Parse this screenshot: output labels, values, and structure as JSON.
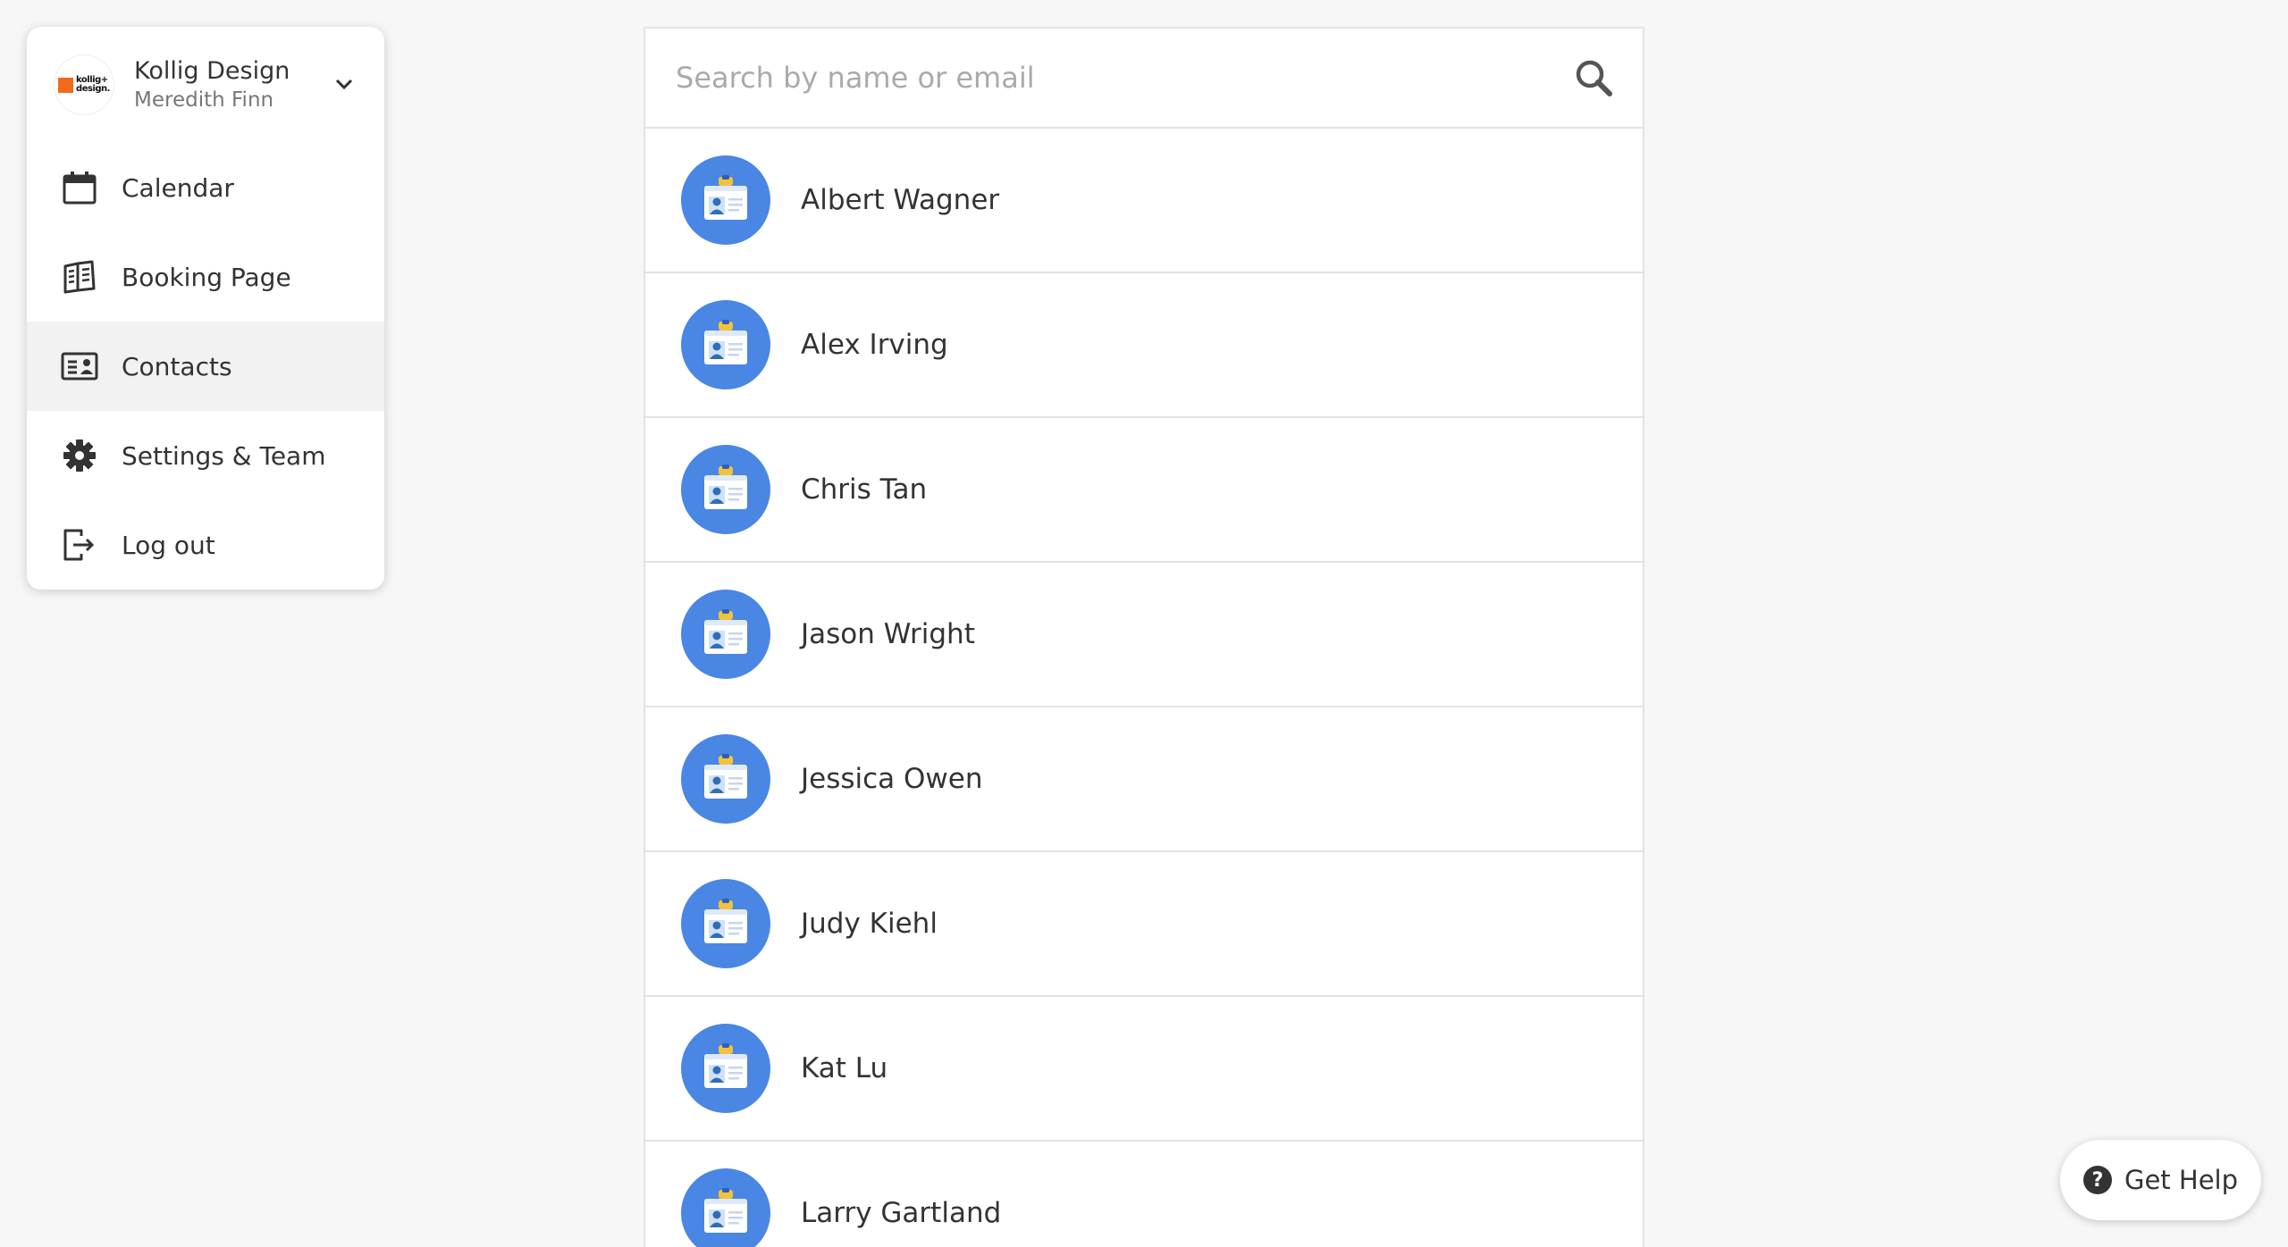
{
  "account": {
    "logo_text_1": "kollig+",
    "logo_text_2": "design.",
    "name": "Kollig Design",
    "user": "Meredith Finn"
  },
  "nav": {
    "items": [
      {
        "label": "Calendar",
        "icon": "calendar-icon"
      },
      {
        "label": "Booking Page",
        "icon": "booking-page-icon"
      },
      {
        "label": "Contacts",
        "icon": "contacts-icon",
        "active": true
      },
      {
        "label": "Settings & Team",
        "icon": "gear-icon"
      },
      {
        "label": "Log out",
        "icon": "logout-icon"
      }
    ]
  },
  "search": {
    "placeholder": "Search by name or email",
    "value": ""
  },
  "contacts": [
    {
      "name": "Albert Wagner"
    },
    {
      "name": "Alex Irving"
    },
    {
      "name": "Chris Tan"
    },
    {
      "name": "Jason Wright"
    },
    {
      "name": "Jessica Owen"
    },
    {
      "name": "Judy Kiehl"
    },
    {
      "name": "Kat Lu"
    },
    {
      "name": "Larry Gartland"
    }
  ],
  "help": {
    "label": "Get Help",
    "icon_glyph": "?"
  },
  "colors": {
    "accent": "#4a86e4",
    "brand_orange": "#f26a1b",
    "active_nav_bg": "#f2f2f2",
    "page_bg": "#f7f7f7"
  }
}
